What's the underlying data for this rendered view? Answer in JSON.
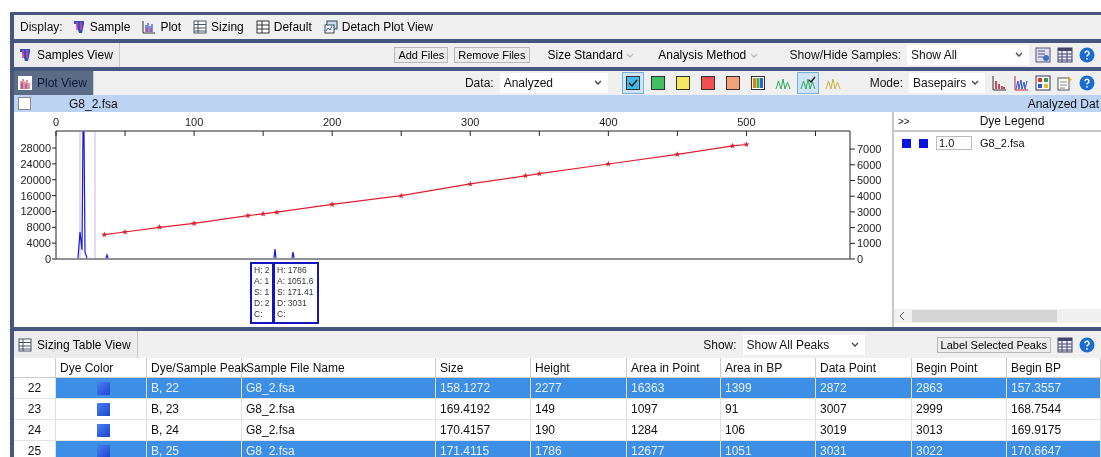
{
  "display_bar": {
    "label": "Display:",
    "items": [
      {
        "kind": "sample",
        "label": "Sample"
      },
      {
        "kind": "plot",
        "label": "Plot"
      },
      {
        "kind": "sizing",
        "label": "Sizing"
      },
      {
        "kind": "default",
        "label": "Default"
      },
      {
        "kind": "detach",
        "label": "Detach Plot View"
      }
    ]
  },
  "samples_bar": {
    "tab": "Samples View",
    "buttons": [
      "Add Files",
      "Remove Files"
    ],
    "menus": [
      "Size Standard",
      "Analysis Method"
    ],
    "show_hide_label": "Show/Hide Samples:",
    "show_hide_value": "Show All"
  },
  "plot_bar": {
    "tab": "Plot View",
    "tab_selected": true,
    "data_label": "Data:",
    "data_value": "Analyzed",
    "filters": [
      {
        "kind": "swatch",
        "color": "#40b8e8",
        "selected": true
      },
      {
        "kind": "swatch",
        "color": "#40c060",
        "selected": false
      },
      {
        "kind": "swatch",
        "color": "#f4e860",
        "selected": false
      },
      {
        "kind": "swatch",
        "color": "#f05050",
        "selected": false
      },
      {
        "kind": "swatch",
        "color": "#f4a078",
        "selected": false
      },
      {
        "kind": "multi",
        "selected": false
      },
      {
        "kind": "peaks",
        "selected": false
      },
      {
        "kind": "peaks_check",
        "selected": true
      },
      {
        "kind": "peaks_yellow",
        "selected": false
      }
    ],
    "mode_label": "Mode:",
    "mode_value": "Basepairs"
  },
  "sample_header": {
    "checked": false,
    "file": "G8_2.fsa",
    "right_text": "Analyzed Dat"
  },
  "plot": {
    "left_axis_ticks": [
      "28000",
      "24000",
      "20000",
      "16000",
      "12000",
      "8000",
      "4000",
      "0"
    ],
    "chart_data": {
      "type": "line",
      "x": [
        35,
        50,
        75,
        100,
        139,
        150,
        160,
        200,
        250,
        300,
        340,
        350,
        400,
        450,
        490,
        500
      ],
      "series": [
        {
          "color": "#e02030",
          "marker": "star",
          "values": [
            1550,
            1720,
            2020,
            2270,
            2760,
            2870,
            2980,
            3480,
            4030,
            4780,
            5300,
            5430,
            6050,
            6660,
            7200,
            7290
          ]
        }
      ],
      "xlim": [
        0,
        575
      ],
      "ylim": [
        0,
        8150
      ],
      "xticks": [
        0,
        100,
        200,
        300,
        400,
        500
      ],
      "yticks": [
        0,
        1000,
        2000,
        3000,
        4000,
        5000,
        6000,
        7000
      ]
    },
    "tooltips": [
      {
        "lines": [
          "H: 2",
          "A: 1",
          "S: 1",
          "D: 2",
          "C:"
        ]
      },
      {
        "lines": [
          "H: 1786",
          "A: 1051.6",
          "S: 171.41",
          "D: 3031",
          "C:"
        ]
      }
    ]
  },
  "dye_legend": {
    "expand": ">>",
    "title": "Dye Legend",
    "rows": [
      {
        "color": "#0a14e0",
        "scale": "1.0",
        "file": "G8_2.fsa"
      }
    ]
  },
  "sizing_bar": {
    "tab": "Sizing Table View",
    "show_label": "Show:",
    "show_value": "Show All Peaks",
    "button": "Label Selected Peaks"
  },
  "table": {
    "columns": [
      "",
      "Dye Color",
      "Dye/Sample Peak",
      "Sample File Name",
      "Size",
      "Height",
      "Area in Point",
      "Area in BP",
      "Data Point",
      "Begin Point",
      "Begin BP"
    ],
    "rows": [
      {
        "selected": true,
        "cells": [
          "22",
          "",
          "B, 22",
          "G8_2.fsa",
          "158.1272",
          "2277",
          "16363",
          "1399",
          "2872",
          "2863",
          "157.3557"
        ]
      },
      {
        "selected": false,
        "cells": [
          "23",
          "",
          "B, 23",
          "G8_2.fsa",
          "169.4192",
          "149",
          "1097",
          "91",
          "3007",
          "2999",
          "168.7544"
        ]
      },
      {
        "selected": false,
        "cells": [
          "24",
          "",
          "B, 24",
          "G8_2.fsa",
          "170.4157",
          "190",
          "1284",
          "106",
          "3019",
          "3013",
          "169.9175"
        ]
      },
      {
        "selected": true,
        "cells": [
          "25",
          "",
          "B, 25",
          "G8_2.fsa",
          "171.4115",
          "1786",
          "12677",
          "1051",
          "3031",
          "3022",
          "170.6647"
        ]
      }
    ]
  }
}
